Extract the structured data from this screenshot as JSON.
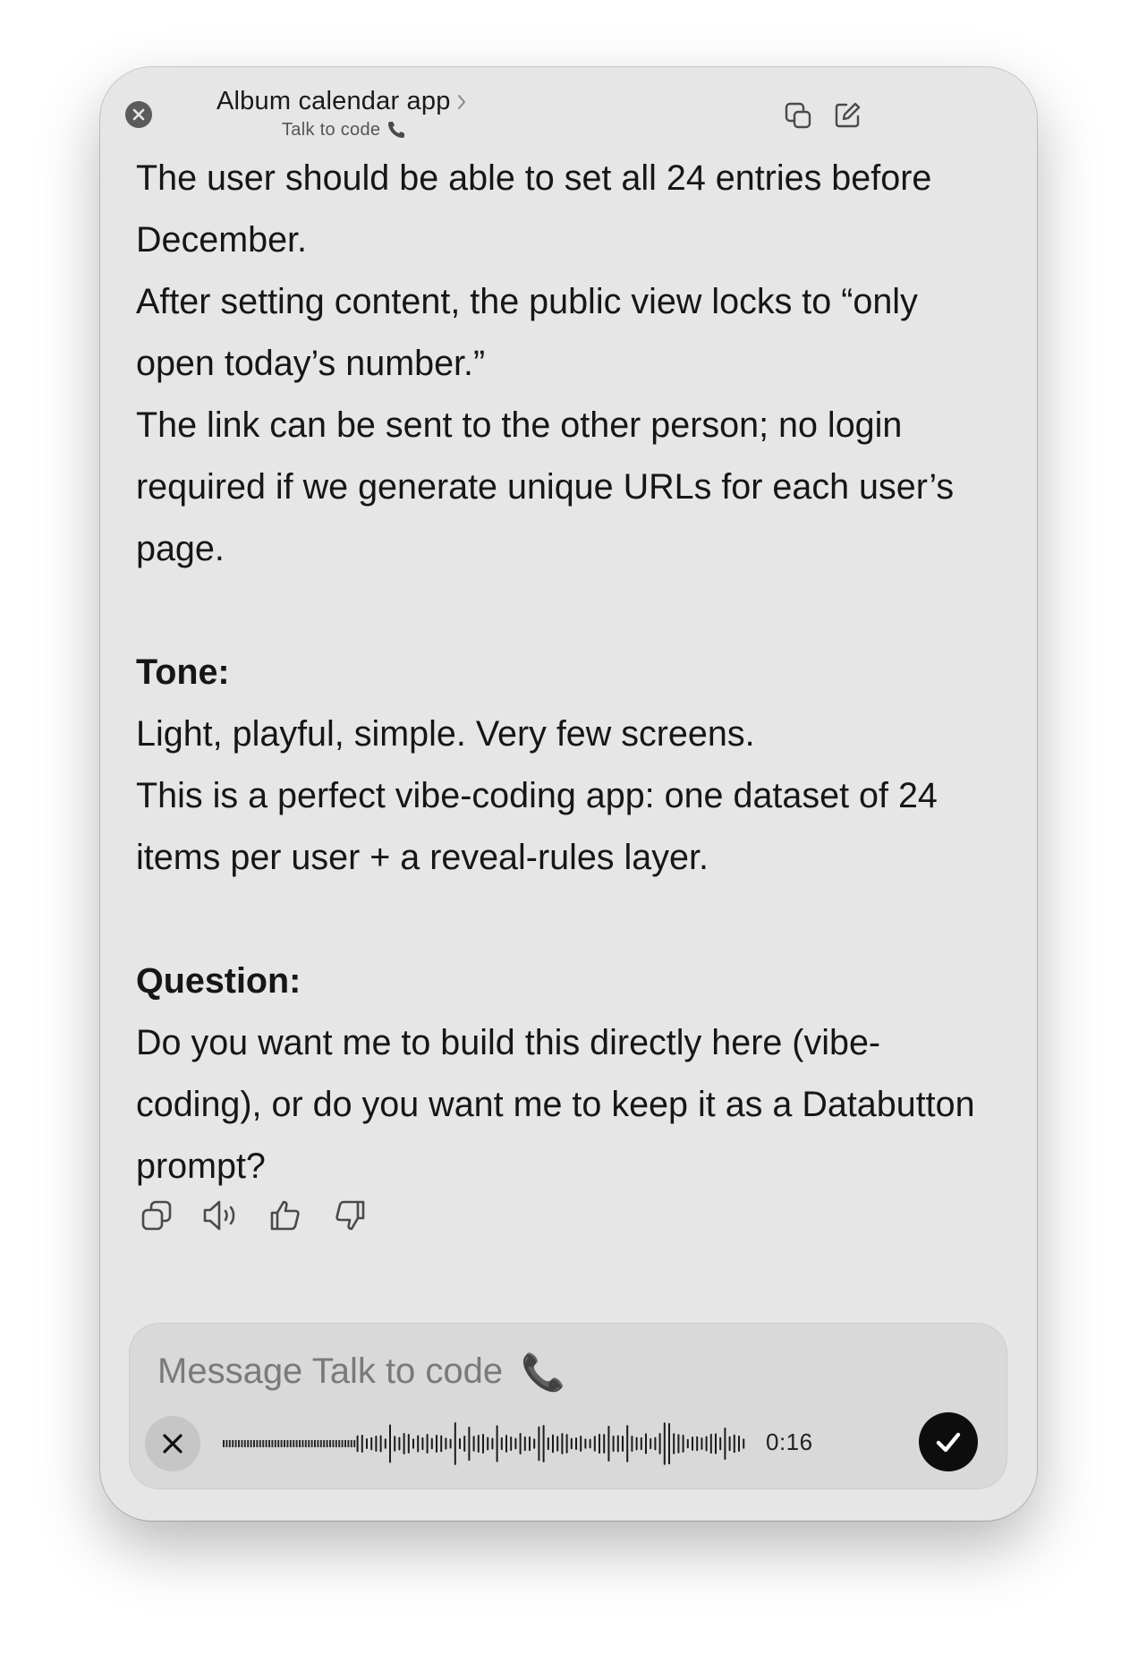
{
  "header": {
    "title": "Album calendar app",
    "subtitle": "Talk to code",
    "subtitle_icon": "phone-icon"
  },
  "message": {
    "paragraphs": [
      "The user should be able to set all 24 entries before December.",
      "After setting content, the public view locks to “only open today’s number.”",
      "The link can be sent to the other person; no login required if we generate unique URLs for each user’s page."
    ],
    "tone_heading": "Tone:",
    "tone_lines": [
      "Light, playful, simple. Very few screens.",
      "This is a perfect vibe-coding app: one dataset of 24 items per user + a reveal-rules layer."
    ],
    "question_heading": "Question:",
    "question_text": "Do you want me to build this directly here (vibe-coding), or do you want me to keep it as a Databutton prompt?"
  },
  "actions": [
    "copy-icon",
    "speaker-icon",
    "thumbs-up-icon",
    "thumbs-down-icon"
  ],
  "composer": {
    "placeholder": "Message Talk to code",
    "placeholder_icon": "📞",
    "timer": "0:16"
  },
  "colors": {
    "window_bg": "#e6e6e6",
    "composer_bg": "#d9d9d9",
    "text": "#161616",
    "confirm_button": "#0d0d0d"
  }
}
